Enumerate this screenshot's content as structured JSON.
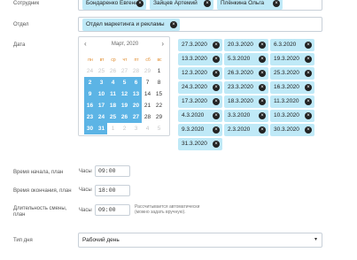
{
  "labels": {
    "employee": "Сотрудник",
    "department": "Отдел",
    "date": "Дата",
    "start_time": "Время начала, план",
    "end_time": "Время окончания, план",
    "duration": "Длительность смены, план",
    "day_type": "Тип дня"
  },
  "employees": [
    "Бондаренко Евгений",
    "Зайцев Артемий",
    "Плёнкина Ольга"
  ],
  "department": "Отдел маркетинга и рекламы",
  "calendar": {
    "title": "Март, 2020",
    "prev_icon": "chevron-left-icon",
    "next_icon": "chevron-right-icon",
    "weekdays": [
      "пн",
      "вт",
      "ср",
      "чт",
      "пт",
      "сб",
      "вс"
    ],
    "weeks": [
      [
        "24",
        "25",
        "26",
        "27",
        "28",
        "29",
        "1"
      ],
      [
        "2",
        "3",
        "4",
        "5",
        "6",
        "7",
        "8"
      ],
      [
        "9",
        "10",
        "11",
        "12",
        "13",
        "14",
        "15"
      ],
      [
        "16",
        "17",
        "18",
        "19",
        "20",
        "21",
        "22"
      ],
      [
        "23",
        "24",
        "25",
        "26",
        "27",
        "28",
        "29"
      ],
      [
        "30",
        "31",
        "1",
        "2",
        "3",
        "4",
        "5"
      ]
    ]
  },
  "dates": [
    "27.3.2020",
    "20.3.2020",
    "6.3.2020",
    "13.3.2020",
    "5.3.2020",
    "19.3.2020",
    "12.3.2020",
    "26.3.2020",
    "25.3.2020",
    "24.3.2020",
    "23.3.2020",
    "16.3.2020",
    "17.3.2020",
    "18.3.2020",
    "11.3.2020",
    "4.3.2020",
    "3.3.2020",
    "10.3.2020",
    "9.3.2020",
    "2.3.2020",
    "30.3.2020",
    "31.3.2020"
  ],
  "hours_label": "Часы",
  "start_time": "09:00",
  "end_time": "18:00",
  "duration": "09:00",
  "duration_hint": "Рассчитывается автоматически (можно задать вручную).",
  "day_type": "Рабочий день",
  "remove_icon": "close-icon",
  "caret_icon": "caret-down-icon"
}
